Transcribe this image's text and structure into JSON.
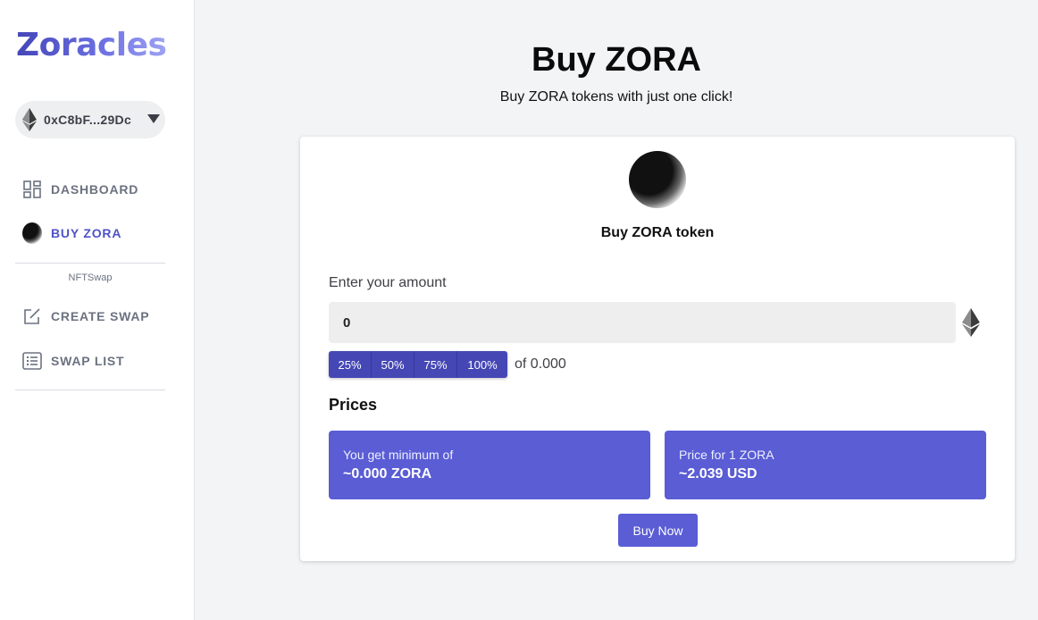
{
  "sidebar": {
    "logo": "Zoracles",
    "wallet": {
      "address": "0xC8bF...29Dc"
    },
    "nav": [
      {
        "label": "DASHBOARD",
        "icon": "dashboard-grid-icon"
      },
      {
        "label": "BUY ZORA",
        "icon": "zora-token-icon",
        "active": true
      }
    ],
    "section_label": "NFTSwap",
    "nftswap_nav": [
      {
        "label": "CREATE SWAP",
        "icon": "edit-square-icon"
      },
      {
        "label": "SWAP LIST",
        "icon": "list-icon"
      }
    ]
  },
  "main": {
    "title": "Buy ZORA",
    "subtitle": "Buy ZORA tokens with just one click!",
    "card": {
      "token_title": "Buy ZORA token",
      "amount_label": "Enter your amount",
      "amount_value": "0",
      "percent_buttons": [
        "25%",
        "50%",
        "75%",
        "100%"
      ],
      "balance_text": "of 0.000",
      "prices_heading": "Prices",
      "prices": [
        {
          "label": "You get minimum of",
          "value": "~0.000 ZORA"
        },
        {
          "label": "Price for 1 ZORA",
          "value": "~2.039 USD"
        }
      ],
      "buy_button": "Buy Now"
    }
  },
  "colors": {
    "accent": "#5a5dd4",
    "accent_dark": "#4547b5",
    "active_nav": "#4f53c7",
    "background": "#f3f4f6"
  }
}
